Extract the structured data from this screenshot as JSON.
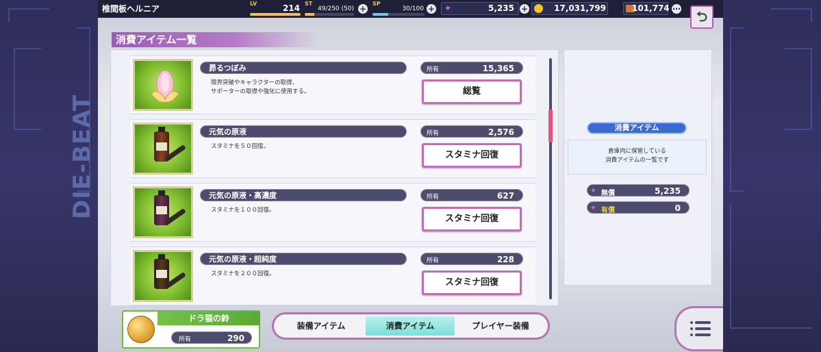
{
  "player": {
    "name": "椎間板ヘルニア",
    "lv_label": "LV",
    "lv": "214",
    "st_label": "ST",
    "st": "49/250 (50)",
    "st_fraction": 0.196,
    "sp_label": "SP",
    "sp": "30/100",
    "sp_fraction": 0.3
  },
  "currency": {
    "gems": "5,235",
    "coins": "17,031,799",
    "tickets": "101,774"
  },
  "header": {
    "title": "消費アイテム一覧"
  },
  "items": [
    {
      "name": "昴るつぼみ",
      "desc": "限界突破やキャラクターの取得、\nサポーターの取得や強化に使用する。",
      "own_label": "所有",
      "own": "15,365",
      "action": "総覧",
      "icon": "flower-bud-icon"
    },
    {
      "name": "元気の原液",
      "desc": "スタミナを５０回復。",
      "own_label": "所有",
      "own": "2,576",
      "action": "スタミナ回復",
      "icon": "potion-bottle-icon"
    },
    {
      "name": "元気の原液・高濃度",
      "desc": "スタミナを１００回復。",
      "own_label": "所有",
      "own": "627",
      "action": "スタミナ回復",
      "icon": "potion-bottle-icon"
    },
    {
      "name": "元気の原液・超純度",
      "desc": "スタミナを２００回復。",
      "own_label": "所有",
      "own": "228",
      "action": "スタミナ回復",
      "icon": "potion-bottle-icon"
    }
  ],
  "info": {
    "title": "消費アイテム",
    "desc": "倉庫内に保管している\n消費アイテムの一覧です",
    "free_label": "無償",
    "free": "5,235",
    "paid_label": "有償",
    "paid": "0"
  },
  "bell": {
    "title": "ドラ猫の鈴",
    "own_label": "所有",
    "own": "290"
  },
  "tabs": [
    {
      "label": "装備アイテム",
      "active": false
    },
    {
      "label": "消費アイテム",
      "active": true
    },
    {
      "label": "プレイヤー装備",
      "active": false
    }
  ],
  "side_text": "DIE-BEAT",
  "colors": {
    "accent": "#b473b4",
    "active_tab": "#7ddfd8",
    "scroll_thumb": "#e8507e",
    "info_title": "#3c6bcf"
  }
}
